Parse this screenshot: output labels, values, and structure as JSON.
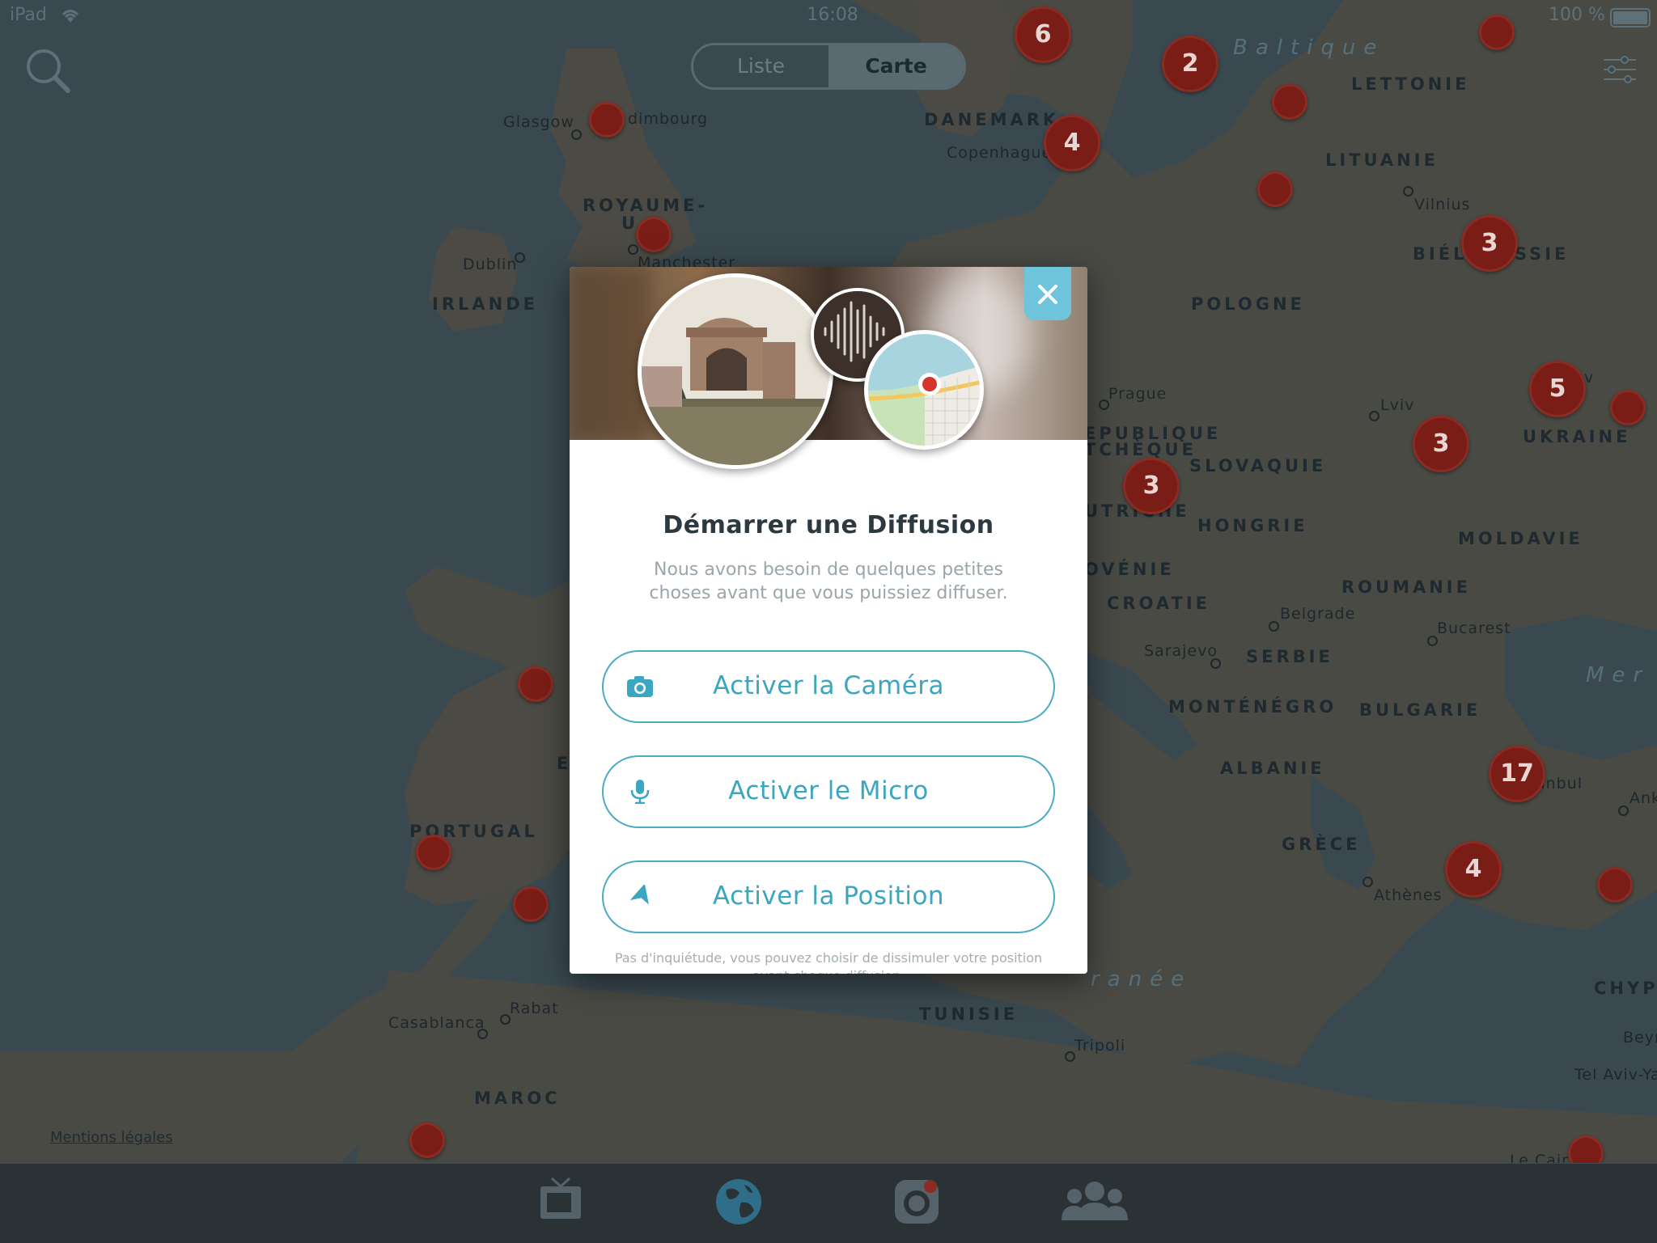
{
  "status_bar": {
    "carrier": "iPad",
    "time": "16:08",
    "battery": "100 %"
  },
  "view_toggle": {
    "list_label": "Liste",
    "map_label": "Carte",
    "selected": "Carte"
  },
  "map": {
    "countries": [
      {
        "id": "danemark",
        "label": "DANEMARK"
      },
      {
        "id": "lettonie",
        "label": "LETTONIE"
      },
      {
        "id": "lituanie",
        "label": "LITUANIE"
      },
      {
        "id": "royaume-uni",
        "label": "ROYAUME-"
      },
      {
        "id": "royaume-uni-2",
        "label": "U"
      },
      {
        "id": "irlande",
        "label": "IRLANDE"
      },
      {
        "id": "pologne",
        "label": "POLOGNE"
      },
      {
        "id": "bielorussie",
        "label": "BIÉL"
      },
      {
        "id": "bielorussie-2",
        "label": "SSIE"
      },
      {
        "id": "rep-tcheque",
        "label": "EPUBLIQUE"
      },
      {
        "id": "rep-tcheque-2",
        "label": "TCHÈQUE"
      },
      {
        "id": "slovaquie",
        "label": "SLOVAQUIE"
      },
      {
        "id": "ukraine",
        "label": "UKRAINE"
      },
      {
        "id": "autriche",
        "label": "UTRICHE"
      },
      {
        "id": "hongrie",
        "label": "HONGRIE"
      },
      {
        "id": "moldavie",
        "label": "MOLDAVIE"
      },
      {
        "id": "slovenie",
        "label": "OVÉNIE"
      },
      {
        "id": "roumanie",
        "label": "ROUMANIE"
      },
      {
        "id": "croatie",
        "label": "CROATIE"
      },
      {
        "id": "serbie",
        "label": "SERBIE"
      },
      {
        "id": "montenegro",
        "label": "MONTÉNÉGRO"
      },
      {
        "id": "bulgarie",
        "label": "BULGARIE"
      },
      {
        "id": "albanie",
        "label": "ALBANIE"
      },
      {
        "id": "grece",
        "label": "GRÈCE"
      },
      {
        "id": "portugal",
        "label": "PORTUGAL"
      },
      {
        "id": "espagne",
        "label": "E"
      },
      {
        "id": "tunisie",
        "label": "TUNISIE"
      },
      {
        "id": "maroc",
        "label": "MAROC"
      },
      {
        "id": "chypre",
        "label": "CHYPR"
      }
    ],
    "cities": [
      {
        "id": "glasgow",
        "label": "Glasgow"
      },
      {
        "id": "edimbourg",
        "label": "dimbourg"
      },
      {
        "id": "copenhague",
        "label": "Copenhague"
      },
      {
        "id": "vilnius",
        "label": "Vilnius"
      },
      {
        "id": "dublin",
        "label": "Dublin"
      },
      {
        "id": "manchester",
        "label": "Manchester"
      },
      {
        "id": "prague",
        "label": "Prague"
      },
      {
        "id": "lviv",
        "label": "Lviv"
      },
      {
        "id": "kiev",
        "label": "v"
      },
      {
        "id": "belgrade",
        "label": "Belgrade"
      },
      {
        "id": "bucarest",
        "label": "Bucarest"
      },
      {
        "id": "sarajevo",
        "label": "Sarajevo"
      },
      {
        "id": "istanbul",
        "label": "anbul"
      },
      {
        "id": "ankara",
        "label": "Ank"
      },
      {
        "id": "athenes",
        "label": "Athènes"
      },
      {
        "id": "rabat",
        "label": "Rabat"
      },
      {
        "id": "casablanca",
        "label": "Casablanca"
      },
      {
        "id": "tripoli",
        "label": "Tripoli"
      },
      {
        "id": "beyrouth",
        "label": "Beyr"
      },
      {
        "id": "tel-aviv",
        "label": "Tel Aviv-Ya"
      },
      {
        "id": "le-caire",
        "label": "Le Cair"
      }
    ],
    "seas": [
      {
        "id": "baltique",
        "label": "Baltique"
      },
      {
        "id": "mer-noire",
        "label": "Mer"
      },
      {
        "id": "mediterranee",
        "label": "ranée"
      }
    ],
    "clusters": [
      {
        "id": "c1",
        "count": "6"
      },
      {
        "id": "c2",
        "count": "2"
      },
      {
        "id": "c3",
        "count": "4"
      },
      {
        "id": "c4",
        "count": "3"
      },
      {
        "id": "c5",
        "count": "5"
      },
      {
        "id": "c6",
        "count": "3"
      },
      {
        "id": "c7",
        "count": "3"
      },
      {
        "id": "c8",
        "count": "17"
      },
      {
        "id": "c9",
        "count": "4"
      }
    ],
    "legal_link": "Mentions légales"
  },
  "modal": {
    "title": "Démarrer une Diffusion",
    "description": "Nous avons besoin de quelques petites choses avant que vous puissiez diffuser.",
    "buttons": {
      "camera": "Activer la Caméra",
      "micro": "Activer le Micro",
      "position": "Activer la Position"
    },
    "footnote": "Pas d'inquiétude, vous pouvez choisir de dissimuler votre position avant chaque diffusion."
  },
  "tabs": [
    {
      "id": "tv",
      "icon": "tv-icon"
    },
    {
      "id": "globe",
      "icon": "globe-icon"
    },
    {
      "id": "broadcast",
      "icon": "camera-record-icon"
    },
    {
      "id": "people",
      "icon": "people-icon"
    }
  ],
  "colors": {
    "accent": "#3aa6c0",
    "close_button": "#6ec4db",
    "marker": "#7a1d17",
    "map_sea": "#3a4950",
    "map_land": "#4a4a45"
  }
}
